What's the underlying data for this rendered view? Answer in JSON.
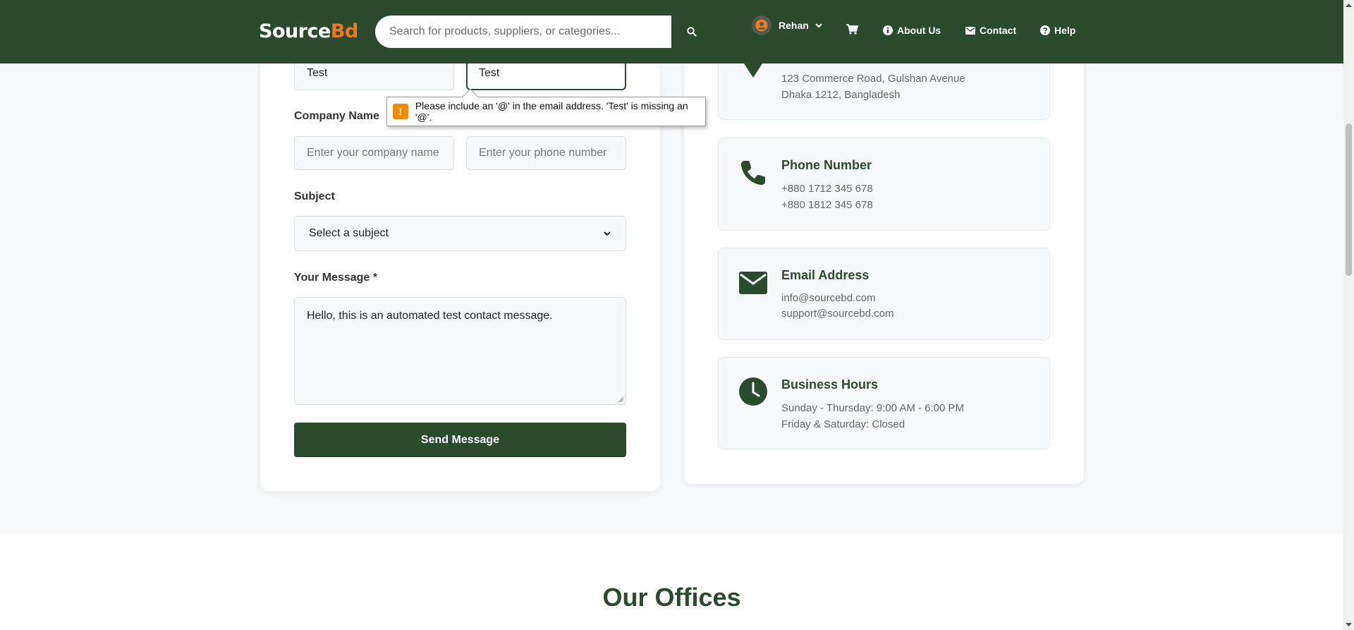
{
  "header": {
    "logo_part1": "Source",
    "logo_part2": "Bd",
    "search_placeholder": "Search for products, suppliers, or categories...",
    "user_name": "Rehan",
    "nav": {
      "about": "About Us",
      "contact": "Contact",
      "help": "Help"
    },
    "colors": {
      "primary": "#2c4a2e",
      "accent": "#f07b1d"
    }
  },
  "form": {
    "first_value": "Test",
    "email_value": "Test",
    "company_label": "Company Name",
    "company_placeholder": "Enter your company name",
    "phone_placeholder": "Enter your phone number",
    "subject_label": "Subject",
    "subject_selected": "Select a subject",
    "message_label": "Your Message *",
    "message_value": "Hello, this is an automated test contact message.",
    "send_label": "Send Message"
  },
  "tooltip": {
    "icon": "!",
    "text": "Please include an '@' in the email address. 'Test' is missing an '@'."
  },
  "contact_info": {
    "address": {
      "icon": "location-pin-icon",
      "line1": "123 Commerce Road, Gulshan Avenue",
      "line2": "Dhaka 1212, Bangladesh"
    },
    "phone": {
      "icon": "phone-icon",
      "title": "Phone Number",
      "line1": "+880 1712 345 678",
      "line2": "+880 1812 345 678"
    },
    "email": {
      "icon": "envelope-icon",
      "title": "Email Address",
      "line1": "info@sourcebd.com",
      "line2": "support@sourcebd.com"
    },
    "hours": {
      "icon": "clock-icon",
      "title": "Business Hours",
      "line1": "Sunday - Thursday: 9:00 AM - 6:00 PM",
      "line2": "Friday & Saturday: Closed"
    }
  },
  "offices": {
    "title": "Our Offices"
  }
}
